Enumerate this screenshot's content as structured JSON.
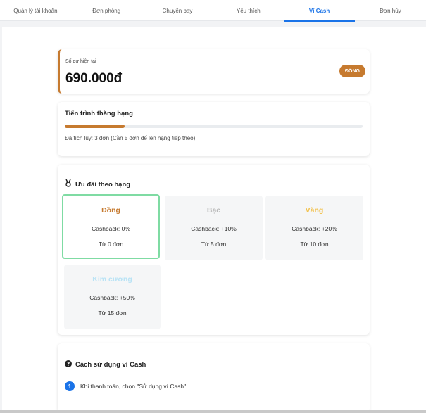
{
  "tabs": [
    {
      "label": "Quản lý tài khoản"
    },
    {
      "label": "Đơn phòng"
    },
    {
      "label": "Chuyến bay"
    },
    {
      "label": "Yêu thích"
    },
    {
      "label": "Ví Cash"
    },
    {
      "label": "Đơn hủy"
    }
  ],
  "active_tab": "Ví Cash",
  "balance": {
    "label": "Số dư hiện tại",
    "amount": "690.000đ",
    "rank_badge": "ĐỒNG"
  },
  "progress": {
    "title": "Tiến trình thăng hạng",
    "fraction": 0.2,
    "note": "Đã tích lũy: 3 đơn (Cần 5 đơn để lên hạng tiếp theo)"
  },
  "tiers": {
    "title": "Ưu đãi theo hạng",
    "items": [
      {
        "name": "Đồng",
        "cashback": "Cashback: 0%",
        "requirement": "Từ 0 đơn",
        "color": "#c67a2f",
        "active": true
      },
      {
        "name": "Bạc",
        "cashback": "Cashback: +10%",
        "requirement": "Từ 5 đơn",
        "color": "#b8b8b8",
        "active": false
      },
      {
        "name": "Vàng",
        "cashback": "Cashback: +20%",
        "requirement": "Từ 10 đơn",
        "color": "#f2c14b",
        "active": false
      },
      {
        "name": "Kim cương",
        "cashback": "Cashback: +50%",
        "requirement": "Từ 15 đơn",
        "color": "#b9e3f5",
        "active": false
      }
    ]
  },
  "howto": {
    "title": "Cách sử dụng ví Cash",
    "steps": [
      {
        "num": "1",
        "text": "Khi thanh toán, chọn \"Sử dụng ví Cash\""
      }
    ]
  },
  "colors": {
    "accent": "#1a73e8",
    "bronze": "#c67a2f",
    "active_border": "#7fdba3"
  }
}
